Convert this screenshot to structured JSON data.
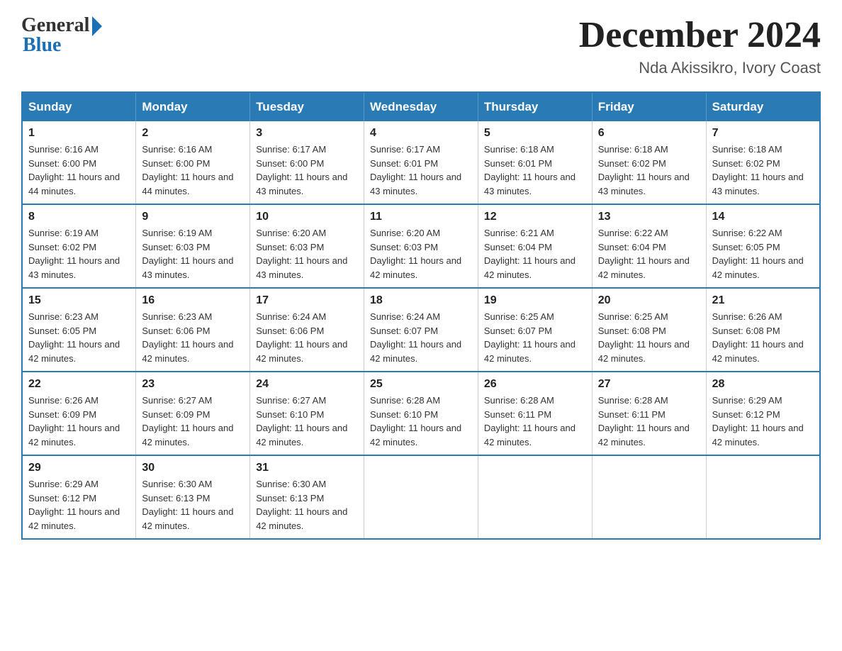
{
  "header": {
    "logo_general": "General",
    "logo_blue": "Blue",
    "month_title": "December 2024",
    "location": "Nda Akissikro, Ivory Coast"
  },
  "calendar": {
    "days_of_week": [
      "Sunday",
      "Monday",
      "Tuesday",
      "Wednesday",
      "Thursday",
      "Friday",
      "Saturday"
    ],
    "weeks": [
      [
        {
          "day": "1",
          "sunrise": "6:16 AM",
          "sunset": "6:00 PM",
          "daylight": "11 hours and 44 minutes."
        },
        {
          "day": "2",
          "sunrise": "6:16 AM",
          "sunset": "6:00 PM",
          "daylight": "11 hours and 44 minutes."
        },
        {
          "day": "3",
          "sunrise": "6:17 AM",
          "sunset": "6:00 PM",
          "daylight": "11 hours and 43 minutes."
        },
        {
          "day": "4",
          "sunrise": "6:17 AM",
          "sunset": "6:01 PM",
          "daylight": "11 hours and 43 minutes."
        },
        {
          "day": "5",
          "sunrise": "6:18 AM",
          "sunset": "6:01 PM",
          "daylight": "11 hours and 43 minutes."
        },
        {
          "day": "6",
          "sunrise": "6:18 AM",
          "sunset": "6:02 PM",
          "daylight": "11 hours and 43 minutes."
        },
        {
          "day": "7",
          "sunrise": "6:18 AM",
          "sunset": "6:02 PM",
          "daylight": "11 hours and 43 minutes."
        }
      ],
      [
        {
          "day": "8",
          "sunrise": "6:19 AM",
          "sunset": "6:02 PM",
          "daylight": "11 hours and 43 minutes."
        },
        {
          "day": "9",
          "sunrise": "6:19 AM",
          "sunset": "6:03 PM",
          "daylight": "11 hours and 43 minutes."
        },
        {
          "day": "10",
          "sunrise": "6:20 AM",
          "sunset": "6:03 PM",
          "daylight": "11 hours and 43 minutes."
        },
        {
          "day": "11",
          "sunrise": "6:20 AM",
          "sunset": "6:03 PM",
          "daylight": "11 hours and 42 minutes."
        },
        {
          "day": "12",
          "sunrise": "6:21 AM",
          "sunset": "6:04 PM",
          "daylight": "11 hours and 42 minutes."
        },
        {
          "day": "13",
          "sunrise": "6:22 AM",
          "sunset": "6:04 PM",
          "daylight": "11 hours and 42 minutes."
        },
        {
          "day": "14",
          "sunrise": "6:22 AM",
          "sunset": "6:05 PM",
          "daylight": "11 hours and 42 minutes."
        }
      ],
      [
        {
          "day": "15",
          "sunrise": "6:23 AM",
          "sunset": "6:05 PM",
          "daylight": "11 hours and 42 minutes."
        },
        {
          "day": "16",
          "sunrise": "6:23 AM",
          "sunset": "6:06 PM",
          "daylight": "11 hours and 42 minutes."
        },
        {
          "day": "17",
          "sunrise": "6:24 AM",
          "sunset": "6:06 PM",
          "daylight": "11 hours and 42 minutes."
        },
        {
          "day": "18",
          "sunrise": "6:24 AM",
          "sunset": "6:07 PM",
          "daylight": "11 hours and 42 minutes."
        },
        {
          "day": "19",
          "sunrise": "6:25 AM",
          "sunset": "6:07 PM",
          "daylight": "11 hours and 42 minutes."
        },
        {
          "day": "20",
          "sunrise": "6:25 AM",
          "sunset": "6:08 PM",
          "daylight": "11 hours and 42 minutes."
        },
        {
          "day": "21",
          "sunrise": "6:26 AM",
          "sunset": "6:08 PM",
          "daylight": "11 hours and 42 minutes."
        }
      ],
      [
        {
          "day": "22",
          "sunrise": "6:26 AM",
          "sunset": "6:09 PM",
          "daylight": "11 hours and 42 minutes."
        },
        {
          "day": "23",
          "sunrise": "6:27 AM",
          "sunset": "6:09 PM",
          "daylight": "11 hours and 42 minutes."
        },
        {
          "day": "24",
          "sunrise": "6:27 AM",
          "sunset": "6:10 PM",
          "daylight": "11 hours and 42 minutes."
        },
        {
          "day": "25",
          "sunrise": "6:28 AM",
          "sunset": "6:10 PM",
          "daylight": "11 hours and 42 minutes."
        },
        {
          "day": "26",
          "sunrise": "6:28 AM",
          "sunset": "6:11 PM",
          "daylight": "11 hours and 42 minutes."
        },
        {
          "day": "27",
          "sunrise": "6:28 AM",
          "sunset": "6:11 PM",
          "daylight": "11 hours and 42 minutes."
        },
        {
          "day": "28",
          "sunrise": "6:29 AM",
          "sunset": "6:12 PM",
          "daylight": "11 hours and 42 minutes."
        }
      ],
      [
        {
          "day": "29",
          "sunrise": "6:29 AM",
          "sunset": "6:12 PM",
          "daylight": "11 hours and 42 minutes."
        },
        {
          "day": "30",
          "sunrise": "6:30 AM",
          "sunset": "6:13 PM",
          "daylight": "11 hours and 42 minutes."
        },
        {
          "day": "31",
          "sunrise": "6:30 AM",
          "sunset": "6:13 PM",
          "daylight": "11 hours and 42 minutes."
        },
        null,
        null,
        null,
        null
      ]
    ]
  }
}
